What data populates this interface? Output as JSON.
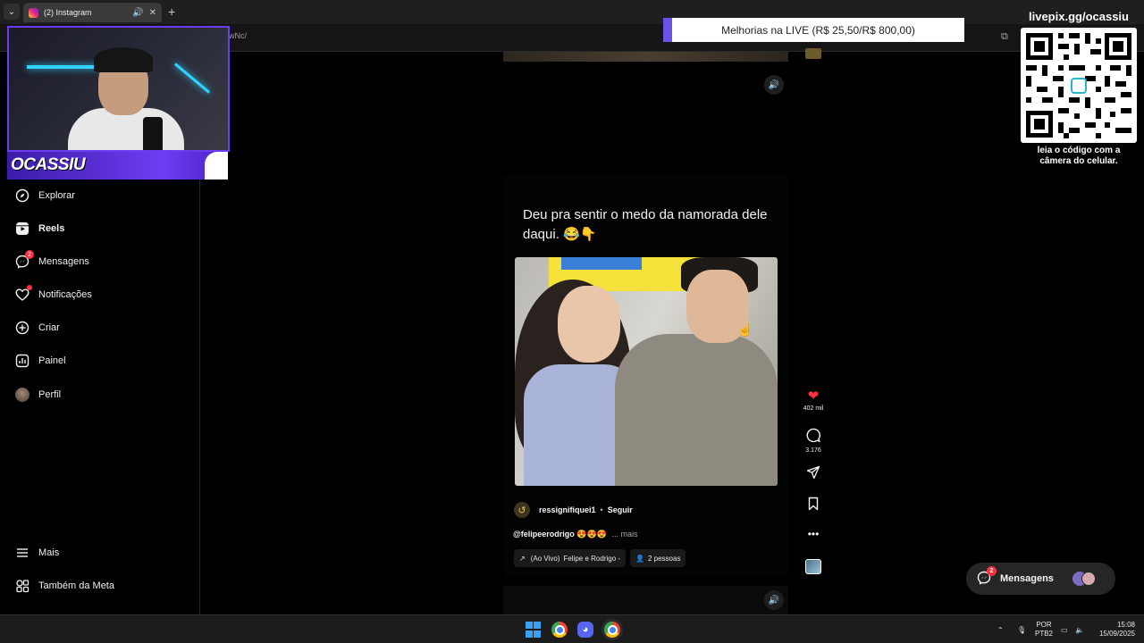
{
  "browser": {
    "tab_title": "(2) Instagram",
    "url_fragment": "wNc/",
    "new_tab_glyph": "+"
  },
  "overlay": {
    "streamer_name": "OCASSIU",
    "live_banner": "Melhorias na LIVE (R$ 25,50/R$ 800,00)",
    "qr_title": "livepix.gg/ocassiu",
    "qr_caption_line1": "leia o código com a",
    "qr_caption_line2": "câmera do celular."
  },
  "sidebar": {
    "items": [
      {
        "label": "Explorar",
        "icon": "compass-icon",
        "badge": ""
      },
      {
        "label": "Reels",
        "icon": "reels-icon",
        "badge": ""
      },
      {
        "label": "Mensagens",
        "icon": "messenger-icon",
        "badge": "2"
      },
      {
        "label": "Notificações",
        "icon": "heart-icon",
        "badge": ""
      },
      {
        "label": "Criar",
        "icon": "plus-square-icon",
        "badge": ""
      },
      {
        "label": "Painel",
        "icon": "chart-icon",
        "badge": ""
      },
      {
        "label": "Perfil",
        "icon": "avatar",
        "badge": ""
      }
    ],
    "more_label": "Mais",
    "meta_label": "Também da Meta"
  },
  "reel": {
    "caption": "Deu pra sentir o medo da namorada dele daqui. 😂👇",
    "author": "ressignifiquei1",
    "separator": "•",
    "follow_label": "Seguir",
    "description_handle": "@felipeerodrigo",
    "description_emojis": "😍😍😍",
    "description_more": "... mais",
    "chip_live_prefix": "(Ao Vivo)",
    "chip_live_text": "Felipe e Rodrigo -",
    "chip_people": "2 pessoas",
    "likes": "402 mil",
    "comments": "3.176"
  },
  "messages_pill": {
    "label": "Mensagens",
    "badge": "2"
  },
  "taskbar": {
    "lang_line1": "POR",
    "lang_line2": "PTB2",
    "time": "15:08",
    "date": "15/09/2025"
  },
  "colors": {
    "accent_purple": "#6b3cf0",
    "like_red": "#ff3040",
    "background": "#000000"
  }
}
